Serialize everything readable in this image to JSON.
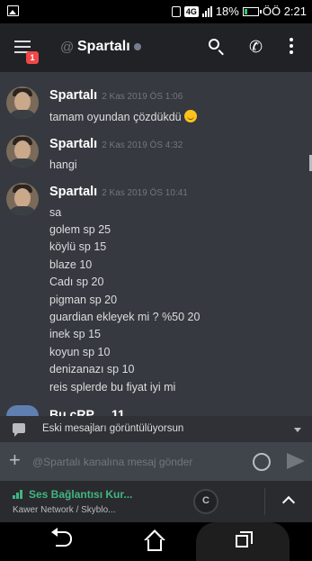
{
  "status_bar": {
    "network": "4G",
    "battery": "18%",
    "time": "ÖÖ 2:21"
  },
  "header": {
    "mention_count": "1",
    "channel_prefix": "@",
    "channel_name": "Spartalı"
  },
  "messages": [
    {
      "author": "Spartalı",
      "timestamp": "2 Kas 2019 ÖS 1:06",
      "lines": [
        "tamam oyundan çözdükdü"
      ],
      "has_emoji": true
    },
    {
      "author": "Spartalı",
      "timestamp": "2 Kas 2019 ÖS 4:32",
      "lines": [
        "hangi"
      ]
    },
    {
      "author": "Spartalı",
      "timestamp": "2 Kas 2019 ÖS 10:41",
      "lines": [
        "sa",
        "golem sp 25",
        "köylü sp 15",
        "blaze 10",
        "Cadı sp 20",
        "pigman sp 20",
        "guardian ekleyek mi ? %50 20",
        "inek sp 15",
        "koyun sp 10",
        "denizanazı sp 10",
        "reis splerde bu fiyat iyi mi"
      ]
    }
  ],
  "partial_author": "Bu cRP ... 11",
  "old_messages_bar": {
    "text": "Eski mesajları görüntülüyorsun"
  },
  "composer": {
    "placeholder": "@Spartalı kanalına mesaj gönder"
  },
  "voice": {
    "title": "Ses Bağlantısı Kur...",
    "subtitle": "Kawer Network / Skyblo..."
  },
  "colors": {
    "accent_green": "#43b581",
    "badge_red": "#f04747",
    "background": "#36393f"
  }
}
